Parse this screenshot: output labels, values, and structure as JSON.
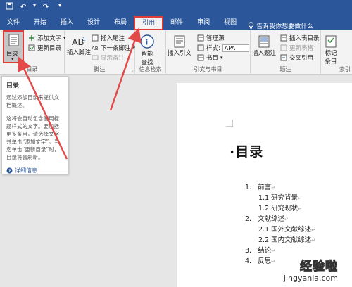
{
  "menu": {
    "tabs": [
      "文件",
      "开始",
      "插入",
      "设计",
      "布局",
      "引用",
      "邮件",
      "审阅",
      "视图"
    ],
    "active_tab": "引用",
    "tell_me": "告诉我你想要做什么"
  },
  "ribbon": {
    "toc": {
      "button": "目录",
      "add_text": "添加文字",
      "update_toc": "更新目录",
      "group": "目录"
    },
    "footnotes": {
      "insert_footnote": "插入脚注",
      "insert_endnote": "插入尾注",
      "next_footnote": "下一条脚注",
      "show_notes": "显示备注",
      "group": "脚注"
    },
    "research": {
      "smart_lookup": "智能查找",
      "group": "信息检索"
    },
    "citations": {
      "insert_citation": "插入引文",
      "manage_sources": "管理源",
      "style_label": "样式:",
      "style_value": "APA",
      "bibliography": "书目",
      "group": "引文与书目"
    },
    "captions": {
      "insert_caption": "插入题注",
      "insert_table_of_figures": "插入表目录",
      "update_table": "更新表格",
      "cross_reference": "交叉引用",
      "group": "题注"
    },
    "index": {
      "mark_entry": "标记条目",
      "group": "索引"
    }
  },
  "tooltip": {
    "title": "目录",
    "p1": "通过添加目录来提供文档概述。",
    "p2": "这将会自动包含使用标题样式的文字。要包括更多条目，请选择文字并单击“添加文字”。当您单击“更新目录”时，目录将会刷新。",
    "more_info": "详细信息"
  },
  "document": {
    "title": "目录",
    "toc": [
      {
        "num": "1.",
        "text": "前言"
      },
      {
        "num": "",
        "text": "1.1 研究背景"
      },
      {
        "num": "",
        "text": "1.2 研究现状"
      },
      {
        "num": "2.",
        "text": "文献综述"
      },
      {
        "num": "",
        "text": "2.1 国外文献综述"
      },
      {
        "num": "",
        "text": "2.2 国内文献综述"
      },
      {
        "num": "3.",
        "text": "结论"
      },
      {
        "num": "4.",
        "text": "反思"
      }
    ]
  },
  "watermark": {
    "top": "经验啦",
    "bottom": "jingyanla.com"
  },
  "colors": {
    "title_bar": "#2b579a",
    "ribbon": "#f3f3f3",
    "highlight": "#e03c3c",
    "arrow": "#e24a4a"
  }
}
